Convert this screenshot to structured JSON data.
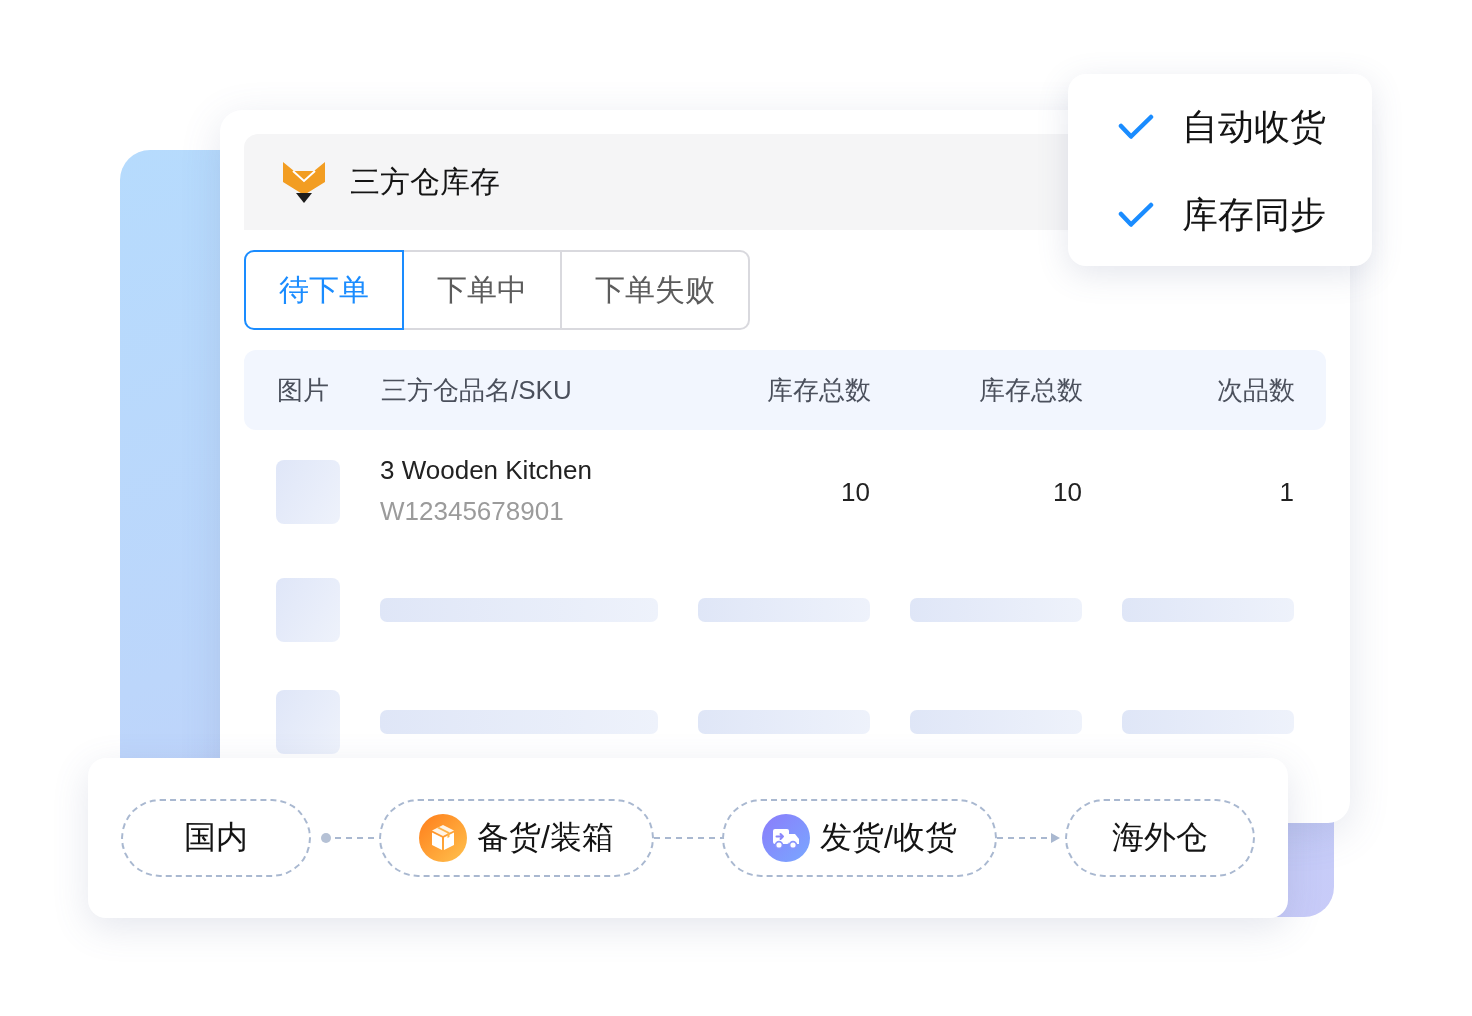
{
  "header": {
    "title": "三方仓库存"
  },
  "tabs": [
    {
      "label": "待下单",
      "selected": true
    },
    {
      "label": "下单中",
      "selected": false
    },
    {
      "label": "下单失败",
      "selected": false
    }
  ],
  "table": {
    "columns": [
      "图片",
      "三方仓品名/SKU",
      "库存总数",
      "库存总数",
      "次品数"
    ],
    "rows": [
      {
        "kind": "product",
        "name": "3 Wooden Kitchen",
        "sku": "W12345678901",
        "values": [
          "10",
          "10",
          "1"
        ]
      },
      {
        "kind": "skeleton"
      },
      {
        "kind": "skeleton"
      }
    ]
  },
  "features": [
    {
      "label": "自动收货",
      "checked": true
    },
    {
      "label": "库存同步",
      "checked": true
    }
  ],
  "flow": {
    "steps": [
      {
        "label": "国内",
        "kind": "plain"
      },
      {
        "label": "备货/装箱",
        "kind": "packing"
      },
      {
        "label": "发货/收货",
        "kind": "shipping"
      },
      {
        "label": "海外仓",
        "kind": "plain"
      }
    ]
  }
}
